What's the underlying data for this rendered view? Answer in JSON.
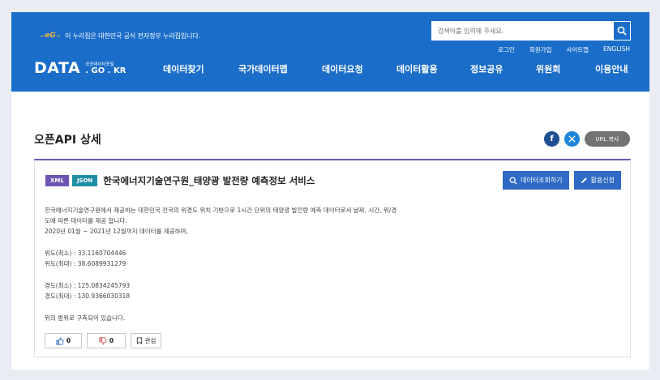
{
  "header": {
    "gov_notice": "이 누리집은 대한민국 공식 전자정부 누리집입니다.",
    "search_placeholder": "검색어를 입력해 주세요.",
    "util_links": [
      "로그인",
      "회원가입",
      "사이트맵",
      "ENGLISH"
    ],
    "logo_main": "DATA",
    "logo_small": "공공데이터포털",
    "logo_domain": ". GO . KR",
    "nav": [
      "데이터찾기",
      "국가데이터맵",
      "데이터요청",
      "데이터활용",
      "정보공유",
      "위원회",
      "이용안내"
    ]
  },
  "page": {
    "title": "오픈API 상세",
    "url_copy": "URL 복사"
  },
  "api": {
    "tags": [
      "XML",
      "JSON"
    ],
    "title": "한국에너지기술연구원_태양광 발전량 예측정보 서비스",
    "btn_query": "데이터조회하기",
    "btn_apply": "활용신청",
    "desc_lines": [
      "한국에너지기술연구원에서 제공하는 대한민국 전국의 위경도 위치 기반으로 1시간 단위의 태양광 발전량 예측 데이터로서 날짜, 시간, 위/경",
      "도에 따른 데이터를 제공 합니다.",
      "2020년 01월 ~ 2021년 12월까지 데이터를 제공하며,"
    ],
    "lat_min": "위도(최소) : 33.1160704446",
    "lat_max": "위도(최대) : 38.6089931279",
    "lon_min": "경도(최소) : 125.0834245793",
    "lon_max": "경도(최대) : 130.9366030318",
    "closing": "위의 범위로 구축되어 있습니다.",
    "like_count": "0",
    "dislike_count": "0",
    "fav_label": "관심"
  },
  "colors": {
    "header_blue": "#1a6dc9",
    "tag_xml": "#6c55b5",
    "tag_json": "#1e8ea3",
    "button_blue": "#2f6ac4",
    "panel_accent": "#6b55b4"
  }
}
